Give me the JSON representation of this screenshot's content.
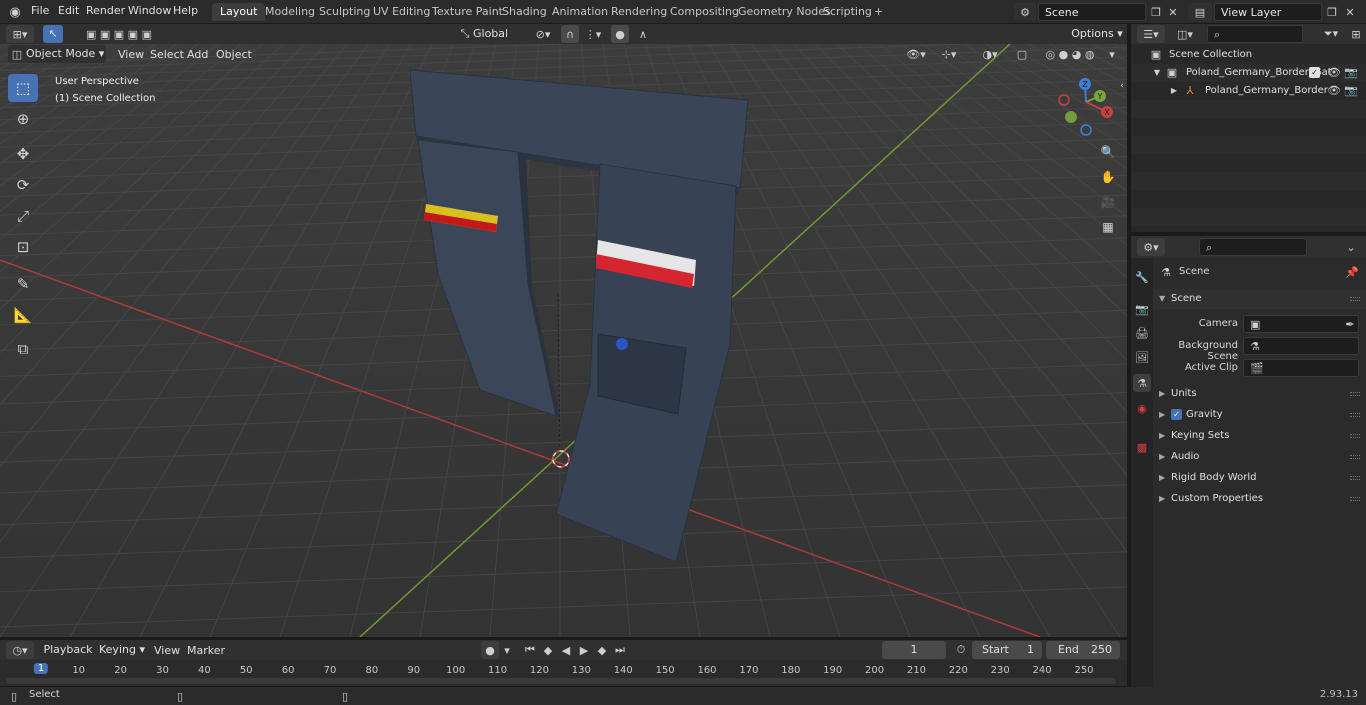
{
  "topbar": {
    "menus": [
      "File",
      "Edit",
      "Render",
      "Window",
      "Help"
    ],
    "workspaces": [
      "Layout",
      "Modeling",
      "Sculpting",
      "UV Editing",
      "Texture Paint",
      "Shading",
      "Animation",
      "Rendering",
      "Compositing",
      "Geometry Nodes",
      "Scripting"
    ],
    "active_workspace": "Layout",
    "add_tab": "+",
    "scene_name": "Scene",
    "view_layer": "View Layer"
  },
  "viewport_header": {
    "mode": "Object Mode",
    "menus": [
      "View",
      "Select",
      "Add",
      "Object"
    ],
    "orientation": "Global",
    "options_label": "Options"
  },
  "viewport": {
    "perspective": "User Perspective",
    "collection": "(1) Scene Collection",
    "gizmo": {
      "z": "Z",
      "y": "Y",
      "x": "X"
    }
  },
  "outliner": {
    "root": "Scene Collection",
    "items": [
      {
        "label": "Poland_Germany_Border_Gat",
        "level": 1
      },
      {
        "label": "Poland_Germany_Border",
        "level": 2
      }
    ]
  },
  "properties": {
    "context": "Scene",
    "panel_title": "Scene",
    "fields": [
      {
        "label": "Camera",
        "value": ""
      },
      {
        "label": "Background Scene",
        "value": ""
      },
      {
        "label": "Active Clip",
        "value": ""
      }
    ],
    "subpanels": [
      "Units",
      "Gravity",
      "Keying Sets",
      "Audio",
      "Rigid Body World",
      "Custom Properties"
    ],
    "gravity_checked": true
  },
  "timeline": {
    "menus": [
      "Playback",
      "Keying",
      "View",
      "Marker"
    ],
    "current_frame": "1",
    "start_label": "Start",
    "start": "1",
    "end_label": "End",
    "end": "250",
    "ticks": [
      "1",
      "10",
      "20",
      "30",
      "40",
      "50",
      "60",
      "70",
      "80",
      "90",
      "100",
      "110",
      "120",
      "130",
      "140",
      "150",
      "160",
      "170",
      "180",
      "190",
      "200",
      "210",
      "220",
      "230",
      "240",
      "250"
    ]
  },
  "statusbar": {
    "left": "Select",
    "version": "2.93.13"
  },
  "colors": {
    "accent": "#4772b3",
    "x_axis": "#c94040",
    "y_axis": "#7aa63a",
    "z_axis": "#3b7fd9"
  }
}
